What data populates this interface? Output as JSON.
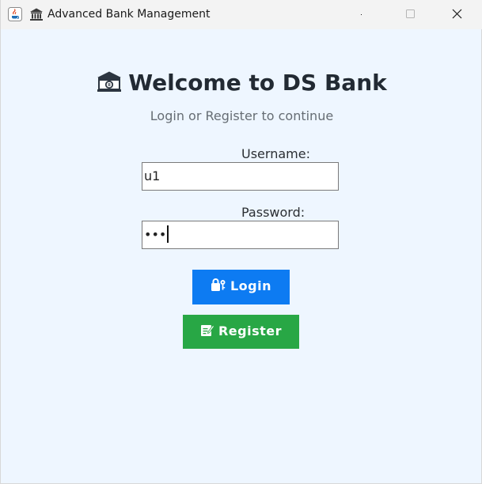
{
  "window": {
    "title": "Advanced Bank Management",
    "app_icon": "java-coffee-cup-icon",
    "title_icon": "bank-building-icon",
    "controls": [
      "minimize",
      "maximize",
      "close"
    ]
  },
  "header": {
    "title": "Welcome to DS Bank",
    "title_icon": "bank-building-icon",
    "subtitle": "Login or Register to continue"
  },
  "form": {
    "username_label": "Username:",
    "username_value": "u1",
    "password_label": "Password:",
    "password_masked": "•••"
  },
  "buttons": {
    "login_label": "Login",
    "login_icon": "lock-key-icon",
    "register_label": "Register",
    "register_icon": "memo-pencil-icon"
  },
  "colors": {
    "background": "#eef6ff",
    "login": "#0d7bf2",
    "register": "#28a745"
  }
}
